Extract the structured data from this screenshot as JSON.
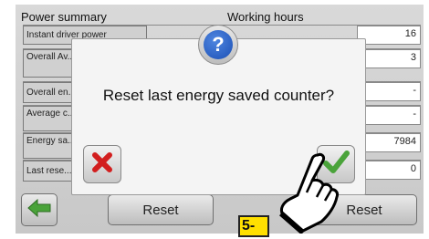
{
  "headers": {
    "power_summary": "Power summary",
    "working_hours": "Working hours"
  },
  "table": {
    "rows": [
      {
        "label": "Instant driver power",
        "value": "16"
      },
      {
        "label": "Overall Av... Power",
        "value": "3"
      },
      {
        "label": "Overall en...",
        "value": "-"
      },
      {
        "label": "Average c... last reset",
        "value": "-"
      },
      {
        "label": "Energy sa... reset",
        "value": "7984"
      },
      {
        "label": "Last rese...",
        "value": "0"
      }
    ]
  },
  "buttons": {
    "reset_left": "Reset",
    "reset_right": "Reset"
  },
  "dialog": {
    "icon": "question-icon",
    "icon_char": "?",
    "message": "Reset last energy saved counter?",
    "cancel_icon": "x-icon",
    "confirm_icon": "check-icon"
  },
  "annotation": {
    "step_label": "5-"
  },
  "colors": {
    "accent_green": "#4aa33a",
    "cancel_red": "#d21e1e",
    "question_blue": "#1b4fb5",
    "step_yellow": "#ffe000"
  }
}
